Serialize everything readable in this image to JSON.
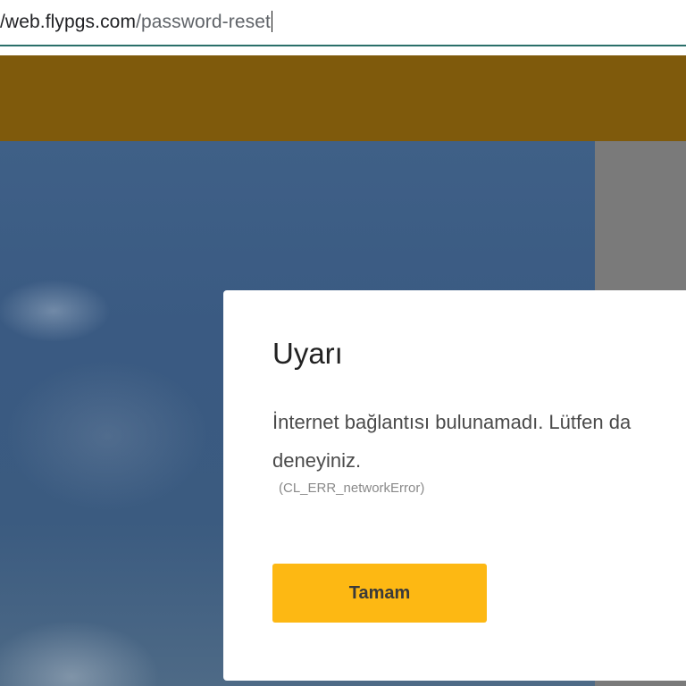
{
  "browser": {
    "url_prefix": "/",
    "url_domain": "/web.flypgs.com",
    "url_path": "/password-reset"
  },
  "modal": {
    "title": "Uyarı",
    "message_line1": "İnternet bağlantısı bulunamadı. Lütfen da",
    "message_line2": "deneyiniz.",
    "error_code": "(CL_ERR_networkError)",
    "ok_label": "Tamam"
  },
  "colors": {
    "header_dimmed": "#7f5a0c",
    "button_yellow": "#fdb813",
    "address_border": "#2a6f6a"
  }
}
